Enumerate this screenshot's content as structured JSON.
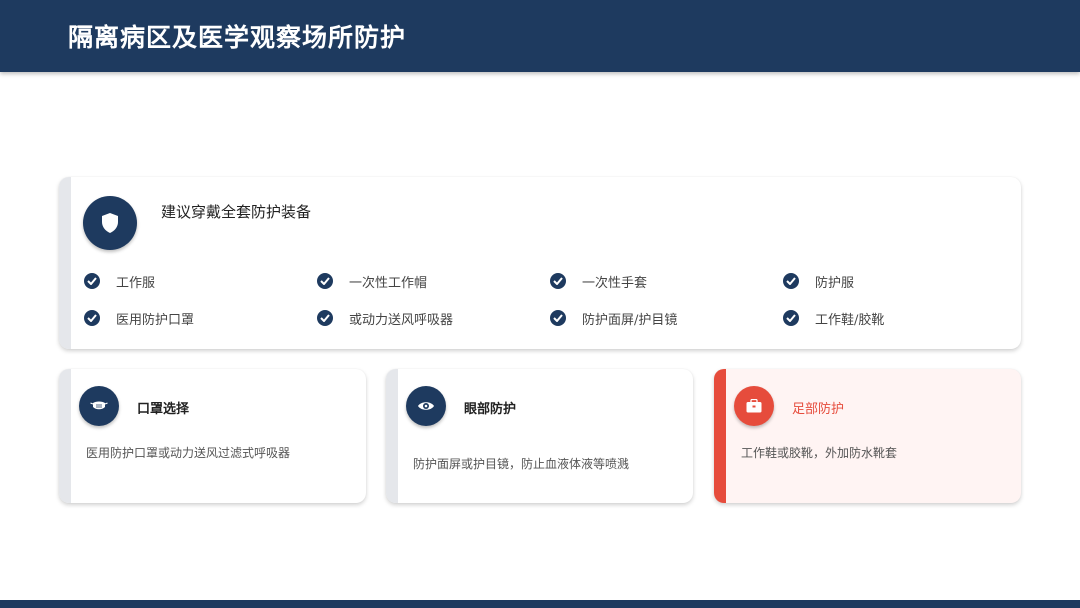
{
  "header": {
    "title": "隔离病区及医学观察场所防护"
  },
  "main_card": {
    "icon": "shield-icon",
    "title": "建议穿戴全套防护装备",
    "items": [
      {
        "label": "工作服",
        "icon": "check-circle-icon"
      },
      {
        "label": "一次性工作帽",
        "icon": "check-circle-icon"
      },
      {
        "label": "一次性手套",
        "icon": "check-circle-icon"
      },
      {
        "label": "防护服",
        "icon": "check-circle-icon"
      },
      {
        "label": "医用防护口罩",
        "icon": "check-circle-icon"
      },
      {
        "label": "或动力送风呼吸器",
        "icon": "check-circle-icon"
      },
      {
        "label": "防护面屏/护目镜",
        "icon": "check-circle-icon"
      },
      {
        "label": "工作鞋/胶靴",
        "icon": "check-circle-icon"
      }
    ]
  },
  "cards": [
    {
      "icon": "mask-icon",
      "title": "口罩选择",
      "desc": "医用防护口罩或动力送风过滤式呼吸器"
    },
    {
      "icon": "eye-icon",
      "title": "眼部防护",
      "desc": "防护面屏或护目镜，防止血液体液等喷溅"
    },
    {
      "icon": "briefcase-icon",
      "title": "足部防护",
      "desc": "工作鞋或胶靴，外加防水靴套"
    }
  ],
  "colors": {
    "navy": "#1e3a5f",
    "accent_red": "#e64c3c",
    "red_card_bg": "#fff4f3"
  }
}
